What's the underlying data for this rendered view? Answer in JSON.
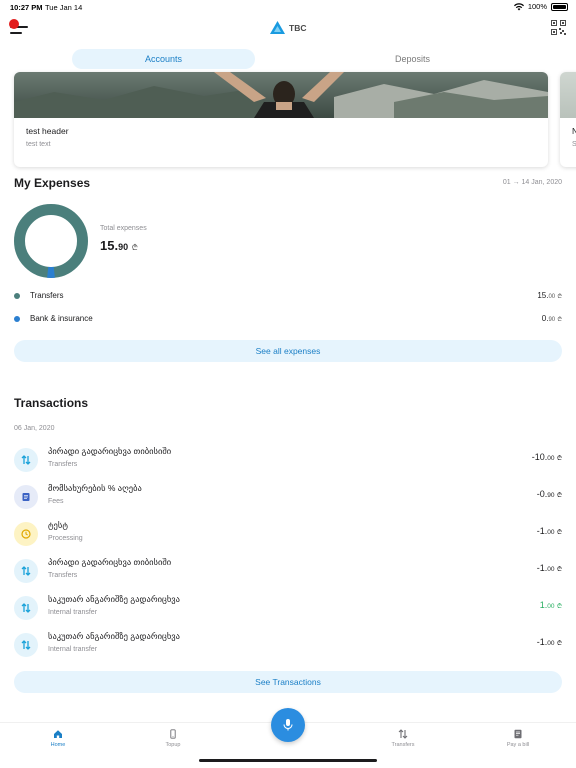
{
  "status": {
    "time": "10:27 PM",
    "date": "Tue Jan 14",
    "battery": "100%"
  },
  "header": {
    "brand": "TBC"
  },
  "tabs": [
    {
      "label": "Accounts",
      "active": true
    },
    {
      "label": "Deposits",
      "active": false
    }
  ],
  "banner": {
    "title": "test header",
    "subtitle": "test text",
    "peek_title": "N",
    "peek_sub": "S"
  },
  "expenses": {
    "title": "My Expenses",
    "range": "01 → 14 Jan, 2020",
    "total_label": "Total expenses",
    "total_int": "15.",
    "total_dec": "90",
    "currency": "₾",
    "breakdown": [
      {
        "label": "Transfers",
        "amount": "15.",
        "dec": "00",
        "color": "#4b7f7c"
      },
      {
        "label": "Bank & insurance",
        "amount": "0.",
        "dec": "90",
        "color": "#2b7fd0"
      }
    ],
    "see_all": "See all expenses"
  },
  "transactions": {
    "title": "Transactions",
    "date": "06 Jan, 2020",
    "items": [
      {
        "name": "პირადი გადარიცხვა თიბისიში",
        "category": "Transfers",
        "amount": "-10.",
        "dec": "00",
        "icon": "transfer-icon",
        "positive": false
      },
      {
        "name": "მომსახურების % აღება",
        "category": "Fees",
        "amount": "-0.",
        "dec": "90",
        "icon": "fee-icon",
        "positive": false
      },
      {
        "name": "ტესტ",
        "category": "Processing",
        "amount": "-1.",
        "dec": "00",
        "icon": "clock-icon",
        "positive": false
      },
      {
        "name": "პირადი გადარიცხვა თიბისიში",
        "category": "Transfers",
        "amount": "-1.",
        "dec": "00",
        "icon": "transfer-icon",
        "positive": false
      },
      {
        "name": "საკუთარ ანგარიშზე გადარიცხვა",
        "category": "Internal transfer",
        "amount": "1.",
        "dec": "00",
        "icon": "transfer-icon",
        "positive": true
      },
      {
        "name": "საკუთარ ანგარიშზე გადარიცხვა",
        "category": "Internal transfer",
        "amount": "-1.",
        "dec": "00",
        "icon": "transfer-icon",
        "positive": false
      }
    ],
    "see_all": "See Transactions"
  },
  "nav": [
    {
      "label": "Home",
      "active": true
    },
    {
      "label": "Topup",
      "active": false
    },
    {
      "label": "Transfers",
      "active": false
    },
    {
      "label": "Pay a bill",
      "active": false
    }
  ],
  "colors": {
    "accent": "#1b7fc6",
    "donut_main": "#4b7f7c",
    "donut_minor": "#2b7fd0",
    "positive": "#27ae60"
  }
}
